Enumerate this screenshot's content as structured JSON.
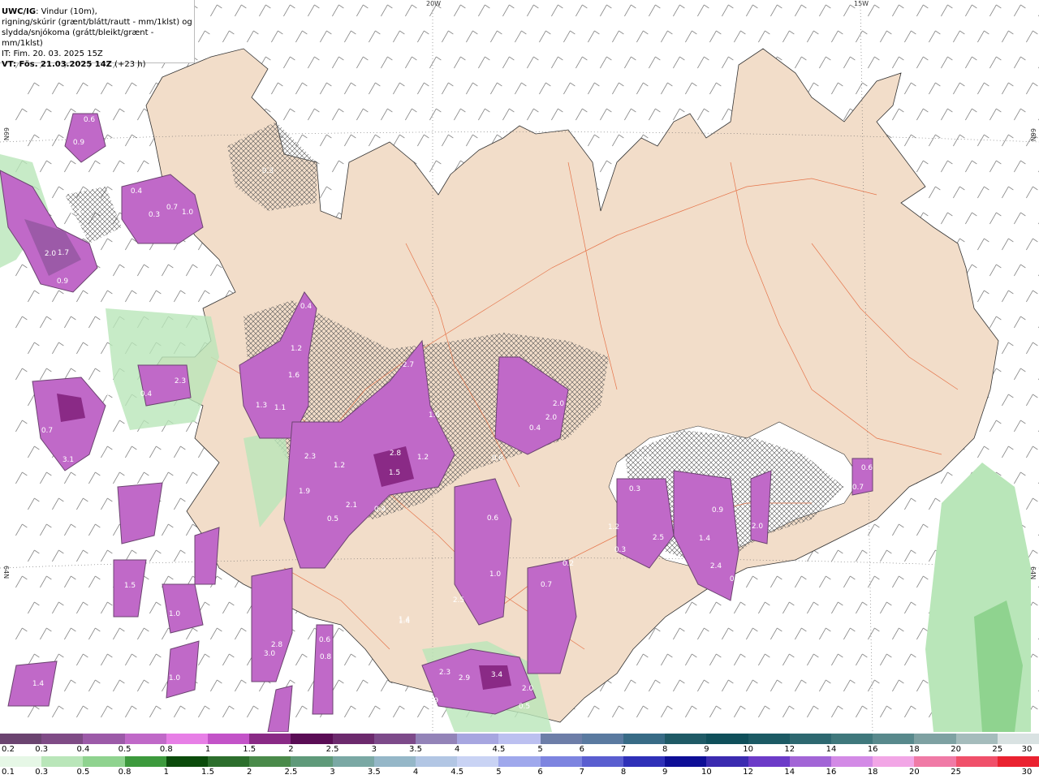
{
  "header": {
    "line1_bold": "UWC/IG",
    "line1_rest": ": Vindur (10m),",
    "line2": "rigning/skúrir (grænt/blátt/rautt - mm/1klst) og",
    "line3": "slydda/snjókoma (grátt/bleikt/grænt - mm/1klst)",
    "line4": "IT: Fim. 20. 03. 2025 15Z",
    "line5_bold": "VT: Fös. 21.03.2025 14Z",
    "line5_rest": " (+23 h)"
  },
  "grid_labels": {
    "lon_20w": "20W",
    "lon_15w": "15W",
    "lat_66n_left": "66N",
    "lat_66n_right": "66N",
    "lat_64n_left": "64N",
    "lat_64n_right": "64N"
  },
  "precip_labels": [
    "0.6",
    "0.3",
    "0.9",
    "0.3",
    "0.3",
    "0.4",
    "0.7",
    "1.0",
    "1.3",
    "0.3",
    "2.0",
    "1.7",
    "0.9",
    "0.5",
    "1.5",
    "1.2",
    "1.6",
    "1.3",
    "1.1",
    "2.3",
    "3.2",
    "0.7",
    "3.1",
    "0.4",
    "0.4",
    "2.7",
    "2.8",
    "1.5",
    "1.6",
    "1.2",
    "2.3",
    "1.2",
    "1.9",
    "0.5",
    "0.4",
    "2.1",
    "2.0",
    "2.0",
    "0.4",
    "0.8",
    "0.6",
    "1.0",
    "2.5",
    "0.7",
    "0.2",
    "1.4",
    "2.3",
    "2.9",
    "3.4",
    "2.0",
    "0.5",
    "0.9",
    "0.4",
    "0.3",
    "1.2",
    "2.5",
    "0.9",
    "1.4",
    "2.4",
    "2.0",
    "0.6",
    "0.3",
    "0.6",
    "0.7",
    "1.4",
    "3.0",
    "2.8",
    "1.0",
    "1.0",
    "1.4",
    "1.5",
    "0.6",
    "0.8"
  ],
  "snow_scale": {
    "colors": [
      "#6b4470",
      "#7f4b86",
      "#9c5aa8",
      "#c069c8",
      "#e77fe6",
      "#c353c8",
      "#8a2a86",
      "#5a0d55",
      "#6c2a6d",
      "#7d4a8a",
      "#9383b8",
      "#a7a6e0",
      "#bcc0f0",
      "#6d7ea8",
      "#5a7aa0",
      "#386b86",
      "#1f5a66",
      "#0f4f5a",
      "#1c5a64",
      "#2d6870",
      "#3f787c",
      "#58898c",
      "#7ea1a2",
      "#a5bcbc",
      "#d9e2e2"
    ],
    "ticks": [
      "0.2",
      "0.3",
      "0.4",
      "0.5",
      "0.8",
      "1",
      "1.5",
      "2",
      "2.5",
      "3",
      "3.5",
      "4",
      "4.5",
      "5",
      "6",
      "7",
      "8",
      "9",
      "10",
      "12",
      "14",
      "16",
      "18",
      "20",
      "25",
      "30"
    ]
  },
  "rain_scale": {
    "colors": [
      "#e6f7e6",
      "#b9e6b9",
      "#8fd38f",
      "#3d9a3d",
      "#0b4b0b",
      "#2c6e2c",
      "#4a8a4a",
      "#5f9a7a",
      "#7aa8a4",
      "#95b7c8",
      "#b2c6e4",
      "#c9d3f4",
      "#9fa8ec",
      "#7d84e0",
      "#5a5ed0",
      "#2f30b8",
      "#0e0e96",
      "#3b2bb0",
      "#6c3bc8",
      "#a265d6",
      "#d38ae6",
      "#f2a6e6",
      "#f07aa6",
      "#f0506a",
      "#ea2230"
    ],
    "ticks": [
      "0.1",
      "0.3",
      "0.5",
      "0.8",
      "1",
      "1.5",
      "2",
      "2.5",
      "3",
      "3.5",
      "4",
      "4.5",
      "5",
      "6",
      "7",
      "8",
      "9",
      "10",
      "12",
      "14",
      "16",
      "18",
      "20",
      "25",
      "30"
    ]
  }
}
